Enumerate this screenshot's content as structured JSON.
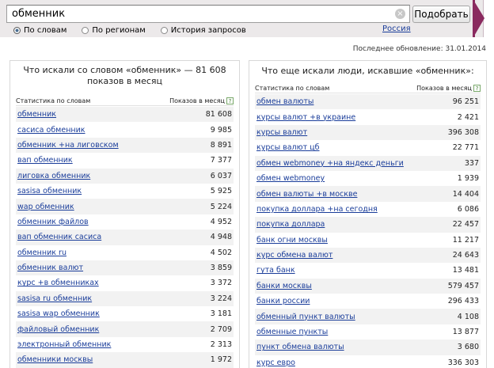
{
  "search": {
    "query": "обменник",
    "submit_label": "Подобрать",
    "clear_symbol": "×"
  },
  "modes": [
    {
      "label": "По словам",
      "checked": true
    },
    {
      "label": "По регионам",
      "checked": false
    },
    {
      "label": "История запросов",
      "checked": false
    }
  ],
  "region_label": "Россия",
  "last_updated": "Последнее обновление: 31.01.2014",
  "left_panel": {
    "title": "Что искали со словом «обменник» — 81 608 показов в месяц",
    "col_phrase": "Статистика по словам",
    "col_count": "Показов в месяц",
    "help_symbol": "?",
    "rows": [
      {
        "phrase": "обменник",
        "count": "81 608"
      },
      {
        "phrase": "сасиса обменник",
        "count": "9 985"
      },
      {
        "phrase": "обменник +на лиговском",
        "count": "8 891"
      },
      {
        "phrase": "вап обменник",
        "count": "7 377"
      },
      {
        "phrase": "лиговка обменник",
        "count": "6 037"
      },
      {
        "phrase": "sasisa обменник",
        "count": "5 925"
      },
      {
        "phrase": "wap обменник",
        "count": "5 224"
      },
      {
        "phrase": "обменник файлов",
        "count": "4 952"
      },
      {
        "phrase": "вап обменник сасиса",
        "count": "4 948"
      },
      {
        "phrase": "обменник ru",
        "count": "4 502"
      },
      {
        "phrase": "обменник валют",
        "count": "3 859"
      },
      {
        "phrase": "курс +в обменниках",
        "count": "3 372"
      },
      {
        "phrase": "sasisa ru обменник",
        "count": "3 224"
      },
      {
        "phrase": "sasisa wap обменник",
        "count": "3 181"
      },
      {
        "phrase": "файловый обменник",
        "count": "2 709"
      },
      {
        "phrase": "электронный обменник",
        "count": "2 313"
      },
      {
        "phrase": "обменники москвы",
        "count": "1 972"
      }
    ]
  },
  "right_panel": {
    "title": "Что еще искали люди, искавшие «обменник»:",
    "col_phrase": "Статистика по словам",
    "col_count": "Показов в месяц",
    "help_symbol": "?",
    "rows": [
      {
        "phrase": "обмен валюты",
        "count": "96 251"
      },
      {
        "phrase": "курсы валют +в украине",
        "count": "2 421"
      },
      {
        "phrase": "курсы валют",
        "count": "396 308"
      },
      {
        "phrase": "курсы валют цб",
        "count": "22 771"
      },
      {
        "phrase": "обмен webmoney +на яндекс деньги",
        "count": "337"
      },
      {
        "phrase": "обмен webmoney",
        "count": "1 939"
      },
      {
        "phrase": "обмен валюты +в москве",
        "count": "14 404"
      },
      {
        "phrase": "покупка доллара +на сегодня",
        "count": "6 086"
      },
      {
        "phrase": "покупка доллара",
        "count": "22 457"
      },
      {
        "phrase": "банк огни москвы",
        "count": "11 217"
      },
      {
        "phrase": "курс обмена валют",
        "count": "24 643"
      },
      {
        "phrase": "гута банк",
        "count": "13 481"
      },
      {
        "phrase": "банки москвы",
        "count": "579 457"
      },
      {
        "phrase": "банки россии",
        "count": "296 433"
      },
      {
        "phrase": "обменный пункт валюты",
        "count": "4 108"
      },
      {
        "phrase": "обменные пункты",
        "count": "13 877"
      },
      {
        "phrase": "пункт обмена валюты",
        "count": "3 680"
      },
      {
        "phrase": "курс евро",
        "count": "336 303"
      }
    ]
  }
}
